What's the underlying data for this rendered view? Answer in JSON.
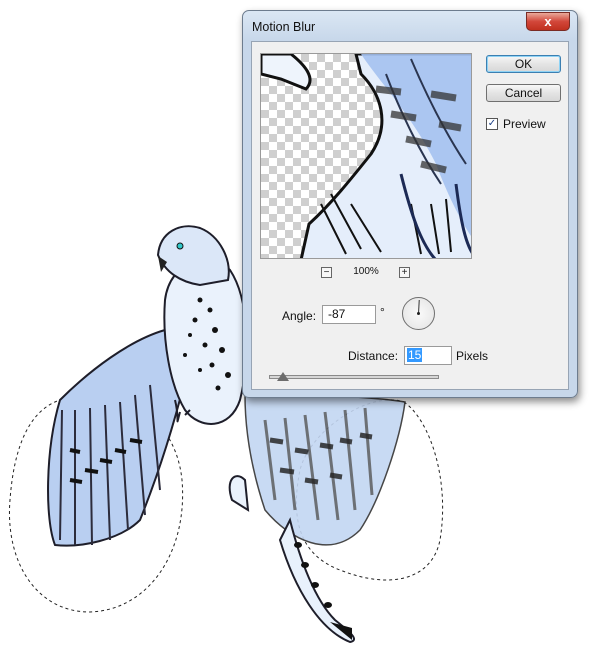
{
  "dialog": {
    "title": "Motion Blur",
    "close_glyph": "x"
  },
  "buttons": {
    "ok": "OK",
    "cancel": "Cancel"
  },
  "preview_toggle": {
    "label": "Preview",
    "checked": true,
    "check_glyph": "✓"
  },
  "zoom": {
    "value": "100%",
    "minus": "−",
    "plus": "+"
  },
  "angle": {
    "label": "Angle:",
    "value": "-87",
    "unit": "°"
  },
  "distance": {
    "label": "Distance:",
    "value": "15",
    "unit": "Pixels",
    "slider_fraction": 0.08
  },
  "icons": {
    "close": "close-icon",
    "dial": "angle-dial-icon"
  },
  "colors": {
    "close_button": "#c7352a",
    "selection_highlight": "#3399ff",
    "feather_blue": "#a9c4ec",
    "titlebar": "#c7d7ea"
  }
}
